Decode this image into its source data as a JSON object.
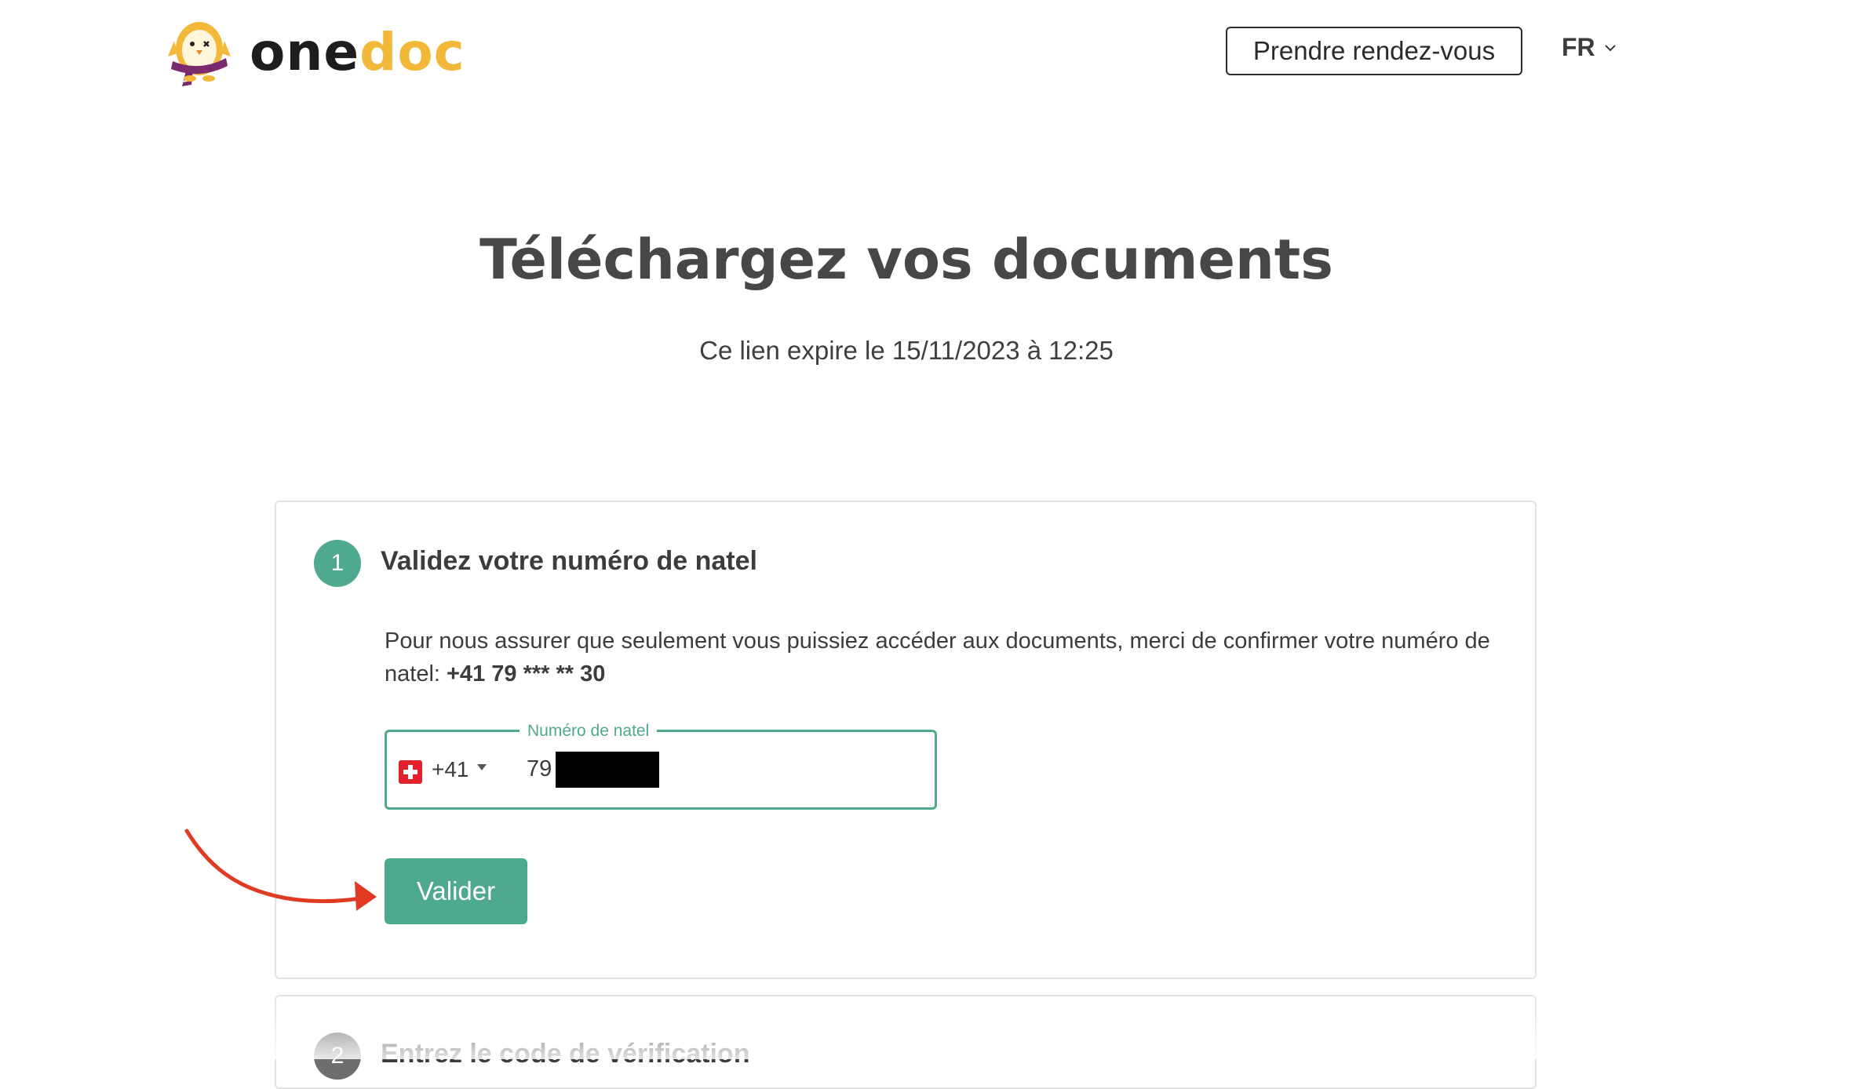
{
  "header": {
    "logo_part1": "one",
    "logo_part2": "doc",
    "appointment_button": "Prendre rendez-vous",
    "language": "FR"
  },
  "main": {
    "title": "Téléchargez vos documents",
    "subtitle": "Ce lien expire le 15/11/2023 à 12:25"
  },
  "step1": {
    "number": "1",
    "title": "Validez votre numéro de natel",
    "description": "Pour nous assurer que seulement vous puissiez accéder aux documents, merci de confirmer votre numéro de natel: ",
    "masked_number": "+41 79 *** ** 30",
    "field_label": "Numéro de natel",
    "country_code": "+41",
    "phone_value": "79",
    "submit_label": "Valider"
  },
  "step2": {
    "number": "2",
    "title": "Entrez le code de vérification"
  },
  "colors": {
    "accent": "#4fa990",
    "brand_yellow": "#f2b83a",
    "annotation_red": "#e03a22"
  }
}
